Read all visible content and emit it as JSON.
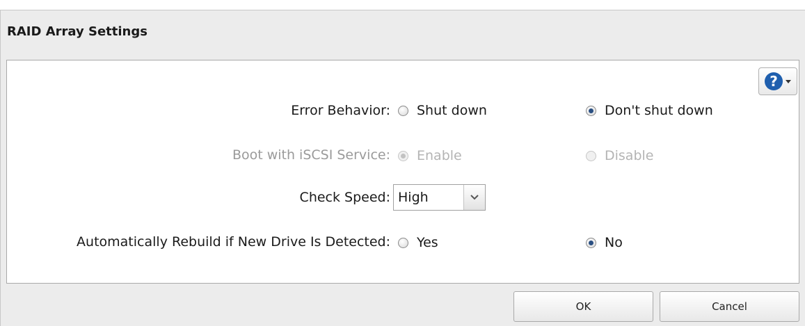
{
  "dialog": {
    "title": "RAID Array Settings"
  },
  "help": {
    "icon": "question-circle-icon",
    "glyph": "?"
  },
  "settings": {
    "error_behavior": {
      "label": "Error Behavior:",
      "options": [
        "Shut down",
        "Don't shut down"
      ],
      "selected": "Don't shut down"
    },
    "boot_iscsi": {
      "label": "Boot with iSCSI Service:",
      "options": [
        "Enable",
        "Disable"
      ],
      "selected": "Enable",
      "disabled": true
    },
    "check_speed": {
      "label": "Check Speed:",
      "value": "High"
    },
    "auto_rebuild": {
      "label": "Automatically Rebuild if New Drive Is Detected:",
      "options": [
        "Yes",
        "No"
      ],
      "selected": "No"
    }
  },
  "buttons": {
    "ok": "OK",
    "cancel": "Cancel"
  },
  "colors": {
    "accent": "#1f5fae",
    "disabled_text": "#9a9a9a"
  }
}
